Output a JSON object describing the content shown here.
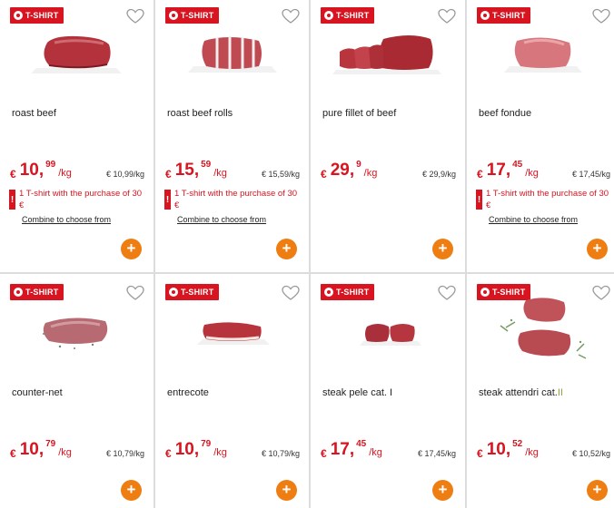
{
  "badge_label": "T-SHIRT",
  "icons": {
    "badge": "football-icon",
    "favorite": "heart-outline-icon",
    "add": "plus-icon",
    "warning": "exclamation-icon"
  },
  "colors": {
    "brand_red": "#d7141f",
    "add_orange": "#ee7d12",
    "category_green": "#8aa33a"
  },
  "products": [
    {
      "title": "roast beef",
      "currency": "€",
      "price_int": "10,",
      "price_dec": "99",
      "unit": "/kg",
      "unit_price": "€ 10,99/kg",
      "promo": "1 T-shirt with the purchase of 30 €",
      "combine": "Combine to choose from"
    },
    {
      "title": "roast beef rolls",
      "currency": "€",
      "price_int": "15,",
      "price_dec": "59",
      "unit": "/kg",
      "unit_price": "€ 15,59/kg",
      "promo": "1 T-shirt with the purchase of 30 €",
      "combine": "Combine to choose from"
    },
    {
      "title": "pure fillet of beef",
      "currency": "€",
      "price_int": "29,",
      "price_dec": "9",
      "unit": "/kg",
      "unit_price": "€ 29,9/kg"
    },
    {
      "title": "beef fondue",
      "currency": "€",
      "price_int": "17,",
      "price_dec": "45",
      "unit": "/kg",
      "unit_price": "€ 17,45/kg",
      "promo": "1 T-shirt with the purchase of 30 €",
      "combine": "Combine to choose from"
    },
    {
      "title": "counter-net",
      "currency": "€",
      "price_int": "10,",
      "price_dec": "79",
      "unit": "/kg",
      "unit_price": "€ 10,79/kg"
    },
    {
      "title": "entrecote",
      "currency": "€",
      "price_int": "10,",
      "price_dec": "79",
      "unit": "/kg",
      "unit_price": "€ 10,79/kg"
    },
    {
      "title": "steak pele cat. I",
      "currency": "€",
      "price_int": "17,",
      "price_dec": "45",
      "unit": "/kg",
      "unit_price": "€ 17,45/kg"
    },
    {
      "title_main": "steak attendri cat.",
      "title_cat": "II",
      "currency": "€",
      "price_int": "10,",
      "price_dec": "52",
      "unit": "/kg",
      "unit_price": "€ 10,52/kg"
    }
  ],
  "add_label": "+",
  "warning_label": "!"
}
